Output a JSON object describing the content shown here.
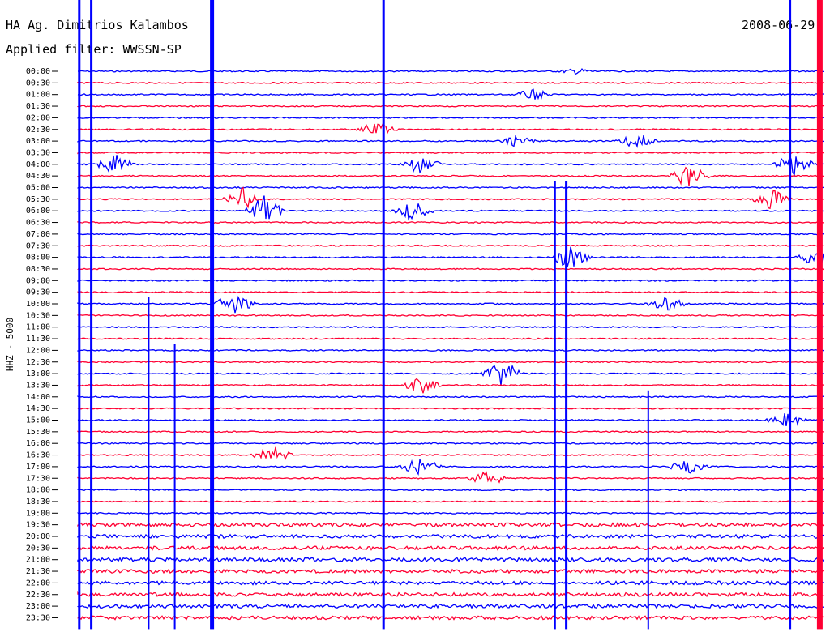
{
  "header": {
    "station": "HA Ag. Dimitrios Kalambos",
    "filter": "Applied filter: WWSSN-SP",
    "date": "2008-06-29"
  },
  "colors": {
    "even": "#0000ff",
    "odd": "#ff0033"
  },
  "chart_data": {
    "type": "line",
    "title": "",
    "ylabel": "HHZ - 5000",
    "xlabel": "",
    "grid": false,
    "row_labels": [
      "00:00",
      "00:30",
      "01:00",
      "01:30",
      "02:00",
      "02:30",
      "03:00",
      "03:30",
      "04:00",
      "04:30",
      "05:00",
      "05:30",
      "06:00",
      "06:30",
      "07:00",
      "07:30",
      "08:00",
      "08:30",
      "09:00",
      "09:30",
      "10:00",
      "10:30",
      "11:00",
      "11:30",
      "12:00",
      "12:30",
      "13:00",
      "13:30",
      "14:00",
      "14:30",
      "15:00",
      "15:30",
      "16:00",
      "16:30",
      "17:00",
      "17:30",
      "18:00",
      "18:30",
      "19:00",
      "19:30",
      "20:00",
      "20:30",
      "21:00",
      "21:30",
      "22:00",
      "22:30",
      "23:00",
      "23:30"
    ],
    "events": [
      {
        "row": 0,
        "x": 0.67,
        "amp": 3
      },
      {
        "row": 2,
        "x": 0.61,
        "amp": 6
      },
      {
        "row": 5,
        "x": 0.4,
        "amp": 9
      },
      {
        "row": 6,
        "x": 0.59,
        "amp": 7
      },
      {
        "row": 6,
        "x": 0.75,
        "amp": 9
      },
      {
        "row": 8,
        "x": 0.05,
        "amp": 12
      },
      {
        "row": 8,
        "x": 0.46,
        "amp": 12
      },
      {
        "row": 8,
        "x": 0.96,
        "amp": 14
      },
      {
        "row": 9,
        "x": 0.82,
        "amp": 14
      },
      {
        "row": 11,
        "x": 0.22,
        "amp": 16
      },
      {
        "row": 11,
        "x": 0.93,
        "amp": 12
      },
      {
        "row": 12,
        "x": 0.25,
        "amp": 18
      },
      {
        "row": 12,
        "x": 0.45,
        "amp": 12
      },
      {
        "row": 16,
        "x": 0.66,
        "amp": 14
      },
      {
        "row": 16,
        "x": 0.99,
        "amp": 10
      },
      {
        "row": 20,
        "x": 0.21,
        "amp": 14
      },
      {
        "row": 20,
        "x": 0.79,
        "amp": 8
      },
      {
        "row": 26,
        "x": 0.57,
        "amp": 16
      },
      {
        "row": 27,
        "x": 0.46,
        "amp": 10
      },
      {
        "row": 30,
        "x": 0.95,
        "amp": 9
      },
      {
        "row": 33,
        "x": 0.26,
        "amp": 13
      },
      {
        "row": 34,
        "x": 0.46,
        "amp": 12
      },
      {
        "row": 34,
        "x": 0.82,
        "amp": 11
      },
      {
        "row": 35,
        "x": 0.55,
        "amp": 9
      }
    ],
    "spikes": [
      {
        "x": 0.002,
        "row_start": 0,
        "row_end": 47,
        "width": 3
      },
      {
        "x": 0.018,
        "row_start": 0,
        "row_end": 47,
        "width": 3
      },
      {
        "x": 0.18,
        "row_start": 0,
        "row_end": 47,
        "width": 5
      },
      {
        "x": 0.41,
        "row_start": 0,
        "row_end": 47,
        "width": 3
      },
      {
        "x": 0.64,
        "row_start": 10,
        "row_end": 47,
        "width": 2
      },
      {
        "x": 0.655,
        "row_start": 10,
        "row_end": 47,
        "width": 3
      },
      {
        "x": 0.095,
        "row_start": 20,
        "row_end": 47,
        "width": 2
      },
      {
        "x": 0.13,
        "row_start": 24,
        "row_end": 47,
        "width": 2
      },
      {
        "x": 0.765,
        "row_start": 28,
        "row_end": 47,
        "width": 2
      },
      {
        "x": 0.955,
        "row_start": 0,
        "row_end": 47,
        "width": 3
      },
      {
        "x": 0.995,
        "row_start": 0,
        "row_end": 47,
        "width": 7
      }
    ]
  }
}
